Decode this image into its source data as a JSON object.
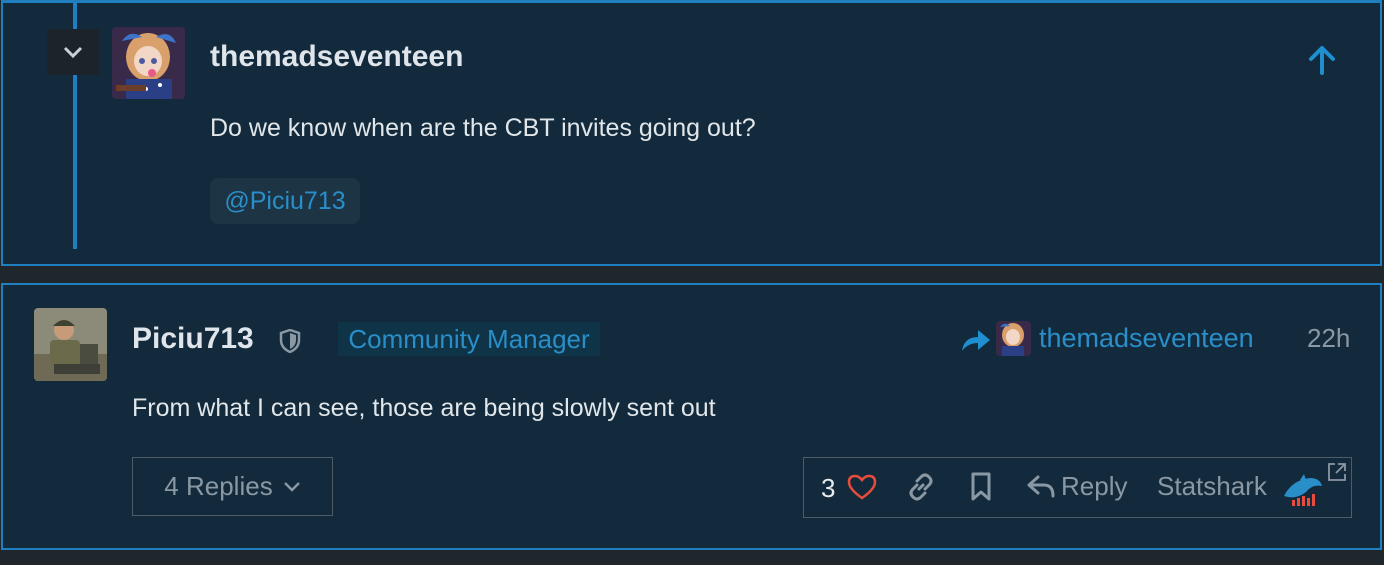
{
  "quoted_post": {
    "username": "themadseventeen",
    "body": "Do we know when are the CBT invites going out?",
    "mention": "@Piciu713"
  },
  "post": {
    "username": "Piciu713",
    "role": "Community Manager",
    "reply_to": "themadseventeen",
    "timestamp": "22h",
    "body": "From what I can see, those are being slowly sent out",
    "replies_label": "4 Replies",
    "likes": "3",
    "reply_label": "Reply",
    "statshark_label": "Statshark"
  },
  "icons": {
    "collapse": "chevron-down-icon",
    "upvote": "arrow-up-icon",
    "moderator": "shield-icon",
    "reply_to": "share-arrow-icon",
    "like": "heart-icon",
    "link": "link-icon",
    "bookmark": "bookmark-icon",
    "reply": "reply-icon",
    "external": "external-link-icon",
    "statshark": "shark-icon"
  },
  "colors": {
    "accent": "#1f7fbf",
    "link": "#2a8ec8",
    "panel": "#122a3b",
    "heart": "#e74c3c"
  }
}
